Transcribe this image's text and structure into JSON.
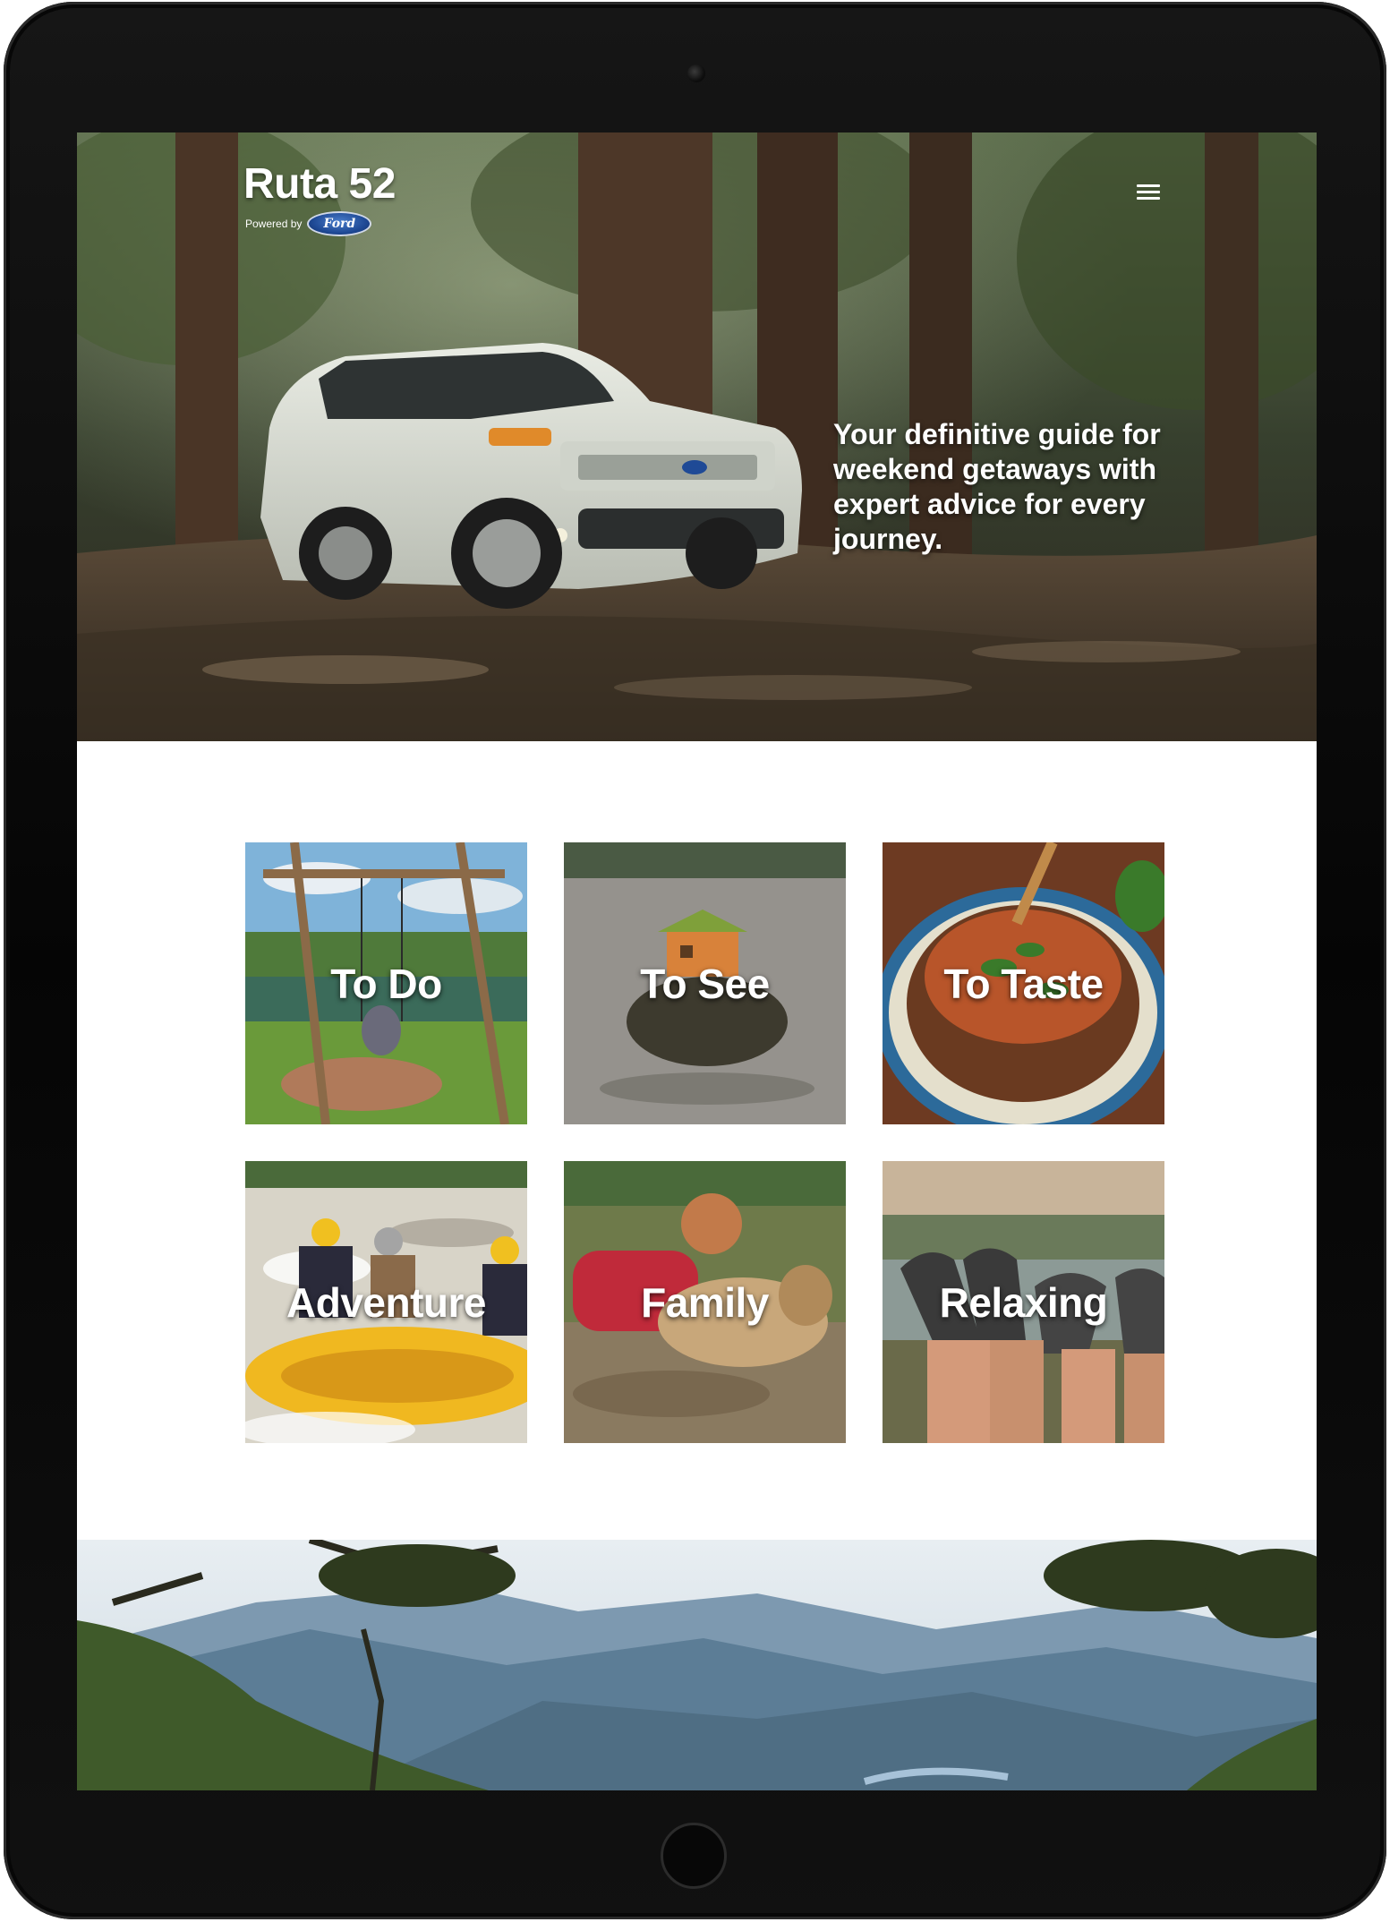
{
  "site": {
    "title": "Ruta 52",
    "powered_by": "Powered by",
    "brand_logo_text": "Ford",
    "tagline": "Your definitive guide for weekend getaways with expert advice for every journey."
  },
  "nav": {
    "menu_icon": "hamburger-menu-icon"
  },
  "categories": [
    {
      "label": "To Do"
    },
    {
      "label": "To See"
    },
    {
      "label": "To Taste"
    },
    {
      "label": "Adventure"
    },
    {
      "label": "Family"
    },
    {
      "label": "Relaxing"
    }
  ],
  "colors": {
    "device_frame": "#0a0a0a",
    "page_background": "#ffffff",
    "text_on_image": "#ffffff",
    "ford_blue": "#1f4a96"
  }
}
